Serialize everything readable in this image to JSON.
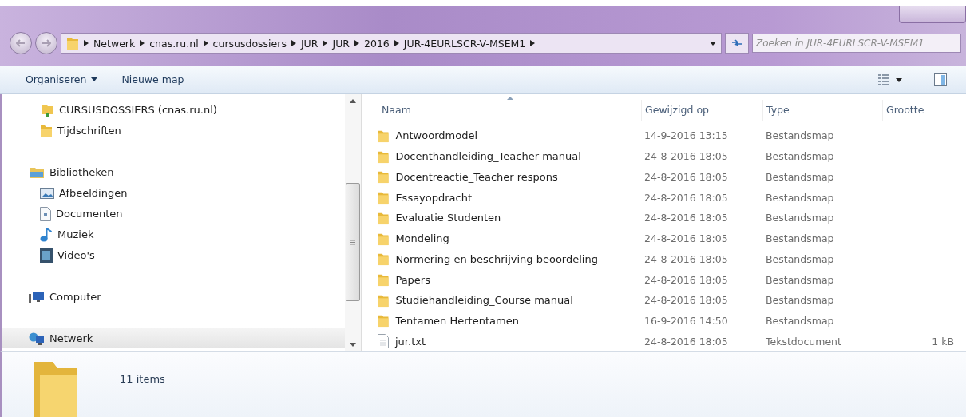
{
  "address_bar": {
    "crumbs": [
      "Netwerk",
      "cnas.ru.nl",
      "cursusdossiers",
      "JUR",
      "JUR",
      "2016",
      "JUR-4EURLSCR-V-MSEM1"
    ]
  },
  "search": {
    "placeholder": "Zoeken in JUR-4EURLSCR-V-MSEM1"
  },
  "toolbar": {
    "buttons": [
      {
        "label": "Organiseren",
        "kind": "menu"
      },
      {
        "label": "Nieuwe map",
        "kind": "plain"
      }
    ]
  },
  "sidebar": {
    "groups": [
      {
        "children": [
          {
            "label": "CURSUSDOSSIERS (cnas.ru.nl)",
            "kind": "share",
            "selected": false
          },
          {
            "label": "Tijdschriften",
            "kind": "folder",
            "selected": false
          }
        ]
      },
      {
        "label": "Bibliotheken",
        "kind": "library",
        "selected": false,
        "children": [
          {
            "label": "Afbeeldingen",
            "kind": "pictures",
            "selected": false
          },
          {
            "label": "Documenten",
            "kind": "documents",
            "selected": false
          },
          {
            "label": "Muziek",
            "kind": "music",
            "selected": false
          },
          {
            "label": "Video's",
            "kind": "video",
            "selected": false
          }
        ]
      },
      {
        "label": "Computer",
        "kind": "computer",
        "selected": false
      },
      {
        "label": "Netwerk",
        "kind": "network",
        "selected": true
      }
    ]
  },
  "table": {
    "columns": [
      {
        "label": "Naam",
        "sorted": true
      },
      {
        "label": "Gewijzigd op",
        "sorted": false
      },
      {
        "label": "Type",
        "sorted": false
      },
      {
        "label": "Grootte",
        "sorted": false
      }
    ],
    "rows": [
      {
        "kind": "folder",
        "name": "Antwoordmodel",
        "modified": "14-9-2016 13:15",
        "type": "Bestandsmap"
      },
      {
        "kind": "folder",
        "name": "Docenthandleiding_Teacher manual",
        "modified": "24-8-2016 18:05",
        "type": "Bestandsmap"
      },
      {
        "kind": "folder",
        "name": "Docentreactie_Teacher respons",
        "modified": "24-8-2016 18:05",
        "type": "Bestandsmap"
      },
      {
        "kind": "folder",
        "name": "Essayopdracht",
        "modified": "24-8-2016 18:05",
        "type": "Bestandsmap"
      },
      {
        "kind": "folder",
        "name": "Evaluatie Studenten",
        "modified": "24-8-2016 18:05",
        "type": "Bestandsmap"
      },
      {
        "kind": "folder",
        "name": "Mondeling",
        "modified": "24-8-2016 18:05",
        "type": "Bestandsmap"
      },
      {
        "kind": "folder",
        "name": "Normering en beschrijving beoordeling",
        "modified": "24-8-2016 18:05",
        "type": "Bestandsmap"
      },
      {
        "kind": "folder",
        "name": "Papers",
        "modified": "24-8-2016 18:05",
        "type": "Bestandsmap"
      },
      {
        "kind": "folder",
        "name": "Studiehandleiding_Course manual",
        "modified": "24-8-2016 18:05",
        "type": "Bestandsmap"
      },
      {
        "kind": "folder",
        "name": "Tentamen Hertentamen",
        "modified": "16-9-2016 14:50",
        "type": "Bestandsmap"
      },
      {
        "kind": "file",
        "name": "jur.txt",
        "modified": "24-8-2016 18:05",
        "type": "Tekstdocument",
        "size": "1 kB"
      }
    ]
  },
  "details": {
    "count": "11 items"
  }
}
